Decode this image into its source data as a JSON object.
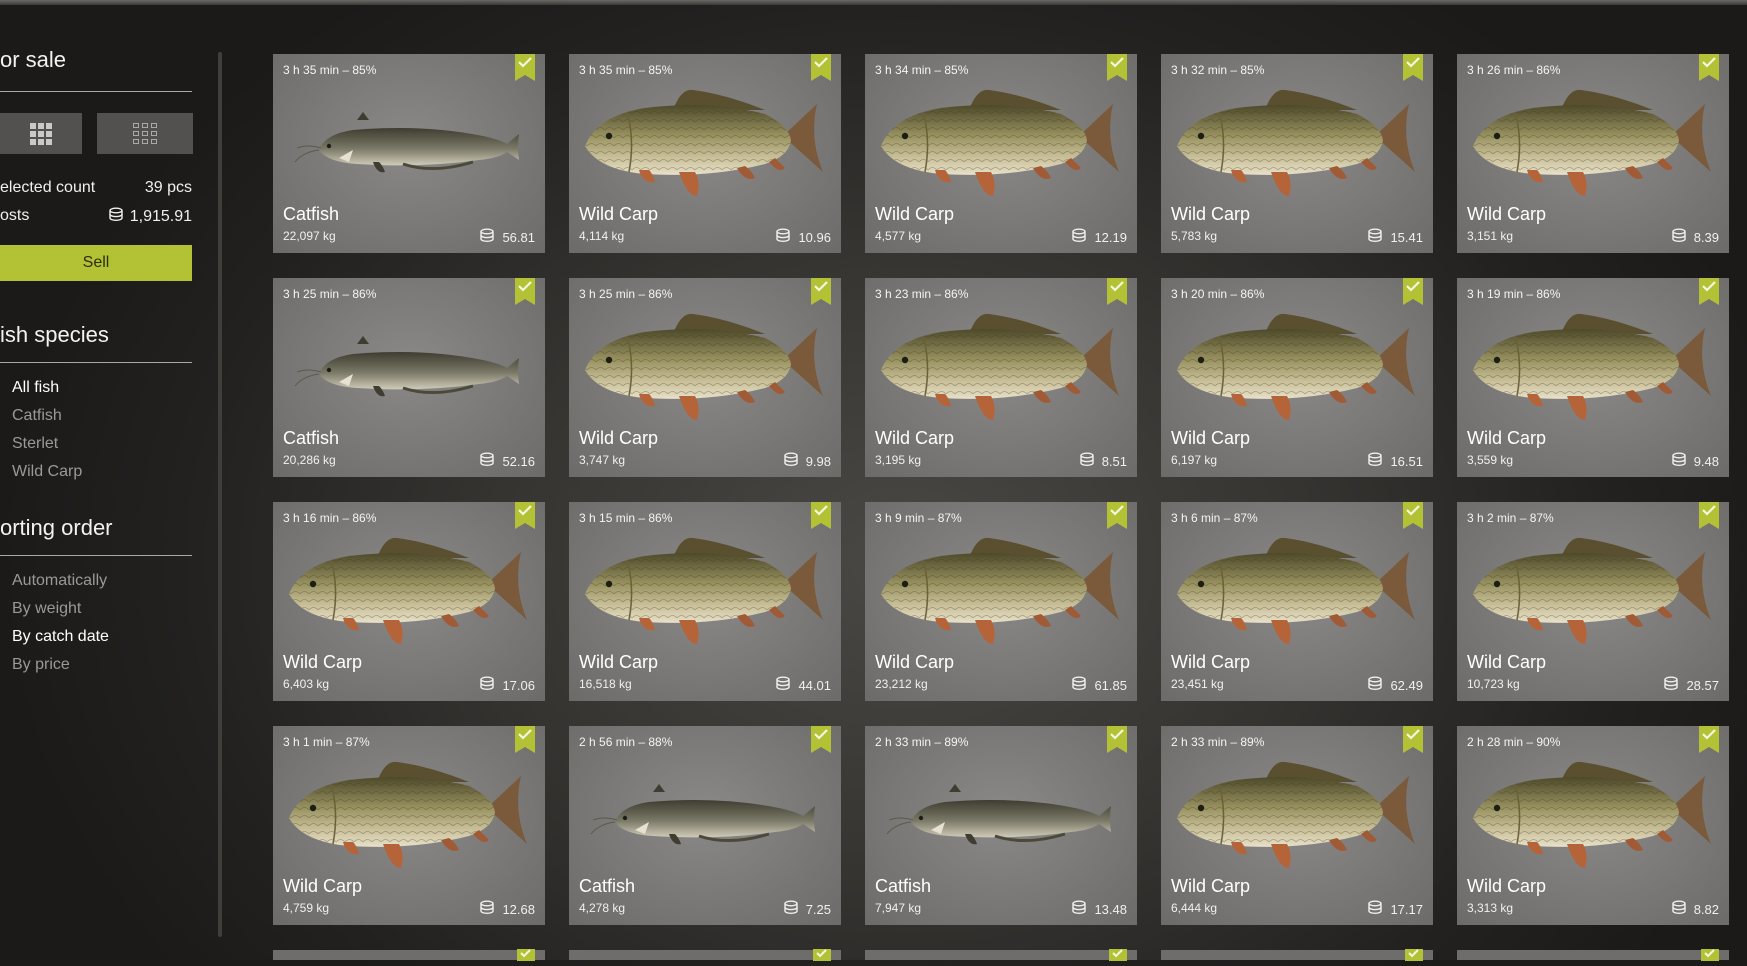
{
  "sidebar": {
    "for_sale_title": "or sale",
    "selected_count_label": "elected count",
    "selected_count_value": "39 pcs",
    "costs_label": "osts",
    "costs_value": "1,915.91",
    "sell_label": "Sell",
    "fish_species_title": "ish species",
    "species": [
      {
        "label": "All fish",
        "active": true
      },
      {
        "label": "Catfish",
        "active": false
      },
      {
        "label": "Sterlet",
        "active": false
      },
      {
        "label": "Wild Carp",
        "active": false
      }
    ],
    "sorting_title": "orting order",
    "sorting": [
      {
        "label": "Automatically",
        "active": false
      },
      {
        "label": "By weight",
        "active": false
      },
      {
        "label": "By catch date",
        "active": true
      },
      {
        "label": "By price",
        "active": false
      }
    ]
  },
  "colors": {
    "accent": "#b2c234",
    "card_bg": "#787775",
    "text_muted": "#9a9996"
  },
  "icons": [
    "grid-large-icon",
    "grid-small-icon",
    "coin-stack-icon",
    "checkmark-ribbon-icon",
    "catfish-image",
    "wild-carp-image"
  ],
  "cards": [
    {
      "time": "3 h 35 min – 85%",
      "name": "Catfish",
      "weight": "22,097 kg",
      "price": "56.81",
      "species": "catfish",
      "selected": true
    },
    {
      "time": "3 h 35 min – 85%",
      "name": "Wild Carp",
      "weight": "4,114 kg",
      "price": "10.96",
      "species": "carp",
      "selected": true
    },
    {
      "time": "3 h 34 min – 85%",
      "name": "Wild Carp",
      "weight": "4,577 kg",
      "price": "12.19",
      "species": "carp",
      "selected": true
    },
    {
      "time": "3 h 32 min – 85%",
      "name": "Wild Carp",
      "weight": "5,783 kg",
      "price": "15.41",
      "species": "carp",
      "selected": true
    },
    {
      "time": "3 h 26 min – 86%",
      "name": "Wild Carp",
      "weight": "3,151 kg",
      "price": "8.39",
      "species": "carp",
      "selected": true
    },
    {
      "time": "3 h 25 min – 86%",
      "name": "Catfish",
      "weight": "20,286 kg",
      "price": "52.16",
      "species": "catfish",
      "selected": true
    },
    {
      "time": "3 h 25 min – 86%",
      "name": "Wild Carp",
      "weight": "3,747 kg",
      "price": "9.98",
      "species": "carp",
      "selected": true
    },
    {
      "time": "3 h 23 min – 86%",
      "name": "Wild Carp",
      "weight": "3,195 kg",
      "price": "8.51",
      "species": "carp",
      "selected": true
    },
    {
      "time": "3 h 20 min – 86%",
      "name": "Wild Carp",
      "weight": "6,197 kg",
      "price": "16.51",
      "species": "carp",
      "selected": true
    },
    {
      "time": "3 h 19 min – 86%",
      "name": "Wild Carp",
      "weight": "3,559 kg",
      "price": "9.48",
      "species": "carp",
      "selected": true
    },
    {
      "time": "3 h 16 min – 86%",
      "name": "Wild Carp",
      "weight": "6,403 kg",
      "price": "17.06",
      "species": "carp",
      "selected": true
    },
    {
      "time": "3 h 15 min – 86%",
      "name": "Wild Carp",
      "weight": "16,518 kg",
      "price": "44.01",
      "species": "carp",
      "selected": true
    },
    {
      "time": "3 h 9 min – 87%",
      "name": "Wild Carp",
      "weight": "23,212 kg",
      "price": "61.85",
      "species": "carp",
      "selected": true
    },
    {
      "time": "3 h 6 min – 87%",
      "name": "Wild Carp",
      "weight": "23,451 kg",
      "price": "62.49",
      "species": "carp",
      "selected": true
    },
    {
      "time": "3 h 2 min – 87%",
      "name": "Wild Carp",
      "weight": "10,723 kg",
      "price": "28.57",
      "species": "carp",
      "selected": true
    },
    {
      "time": "3 h 1 min – 87%",
      "name": "Wild Carp",
      "weight": "4,759 kg",
      "price": "12.68",
      "species": "carp",
      "selected": true
    },
    {
      "time": "2 h 56 min – 88%",
      "name": "Catfish",
      "weight": "4,278 kg",
      "price": "7.25",
      "species": "catfish",
      "selected": true
    },
    {
      "time": "2 h 33 min – 89%",
      "name": "Catfish",
      "weight": "7,947 kg",
      "price": "13.48",
      "species": "catfish",
      "selected": true
    },
    {
      "time": "2 h 33 min – 89%",
      "name": "Wild Carp",
      "weight": "6,444 kg",
      "price": "17.17",
      "species": "carp",
      "selected": true
    },
    {
      "time": "2 h 28 min – 90%",
      "name": "Wild Carp",
      "weight": "3,313 kg",
      "price": "8.82",
      "species": "carp",
      "selected": true
    }
  ]
}
